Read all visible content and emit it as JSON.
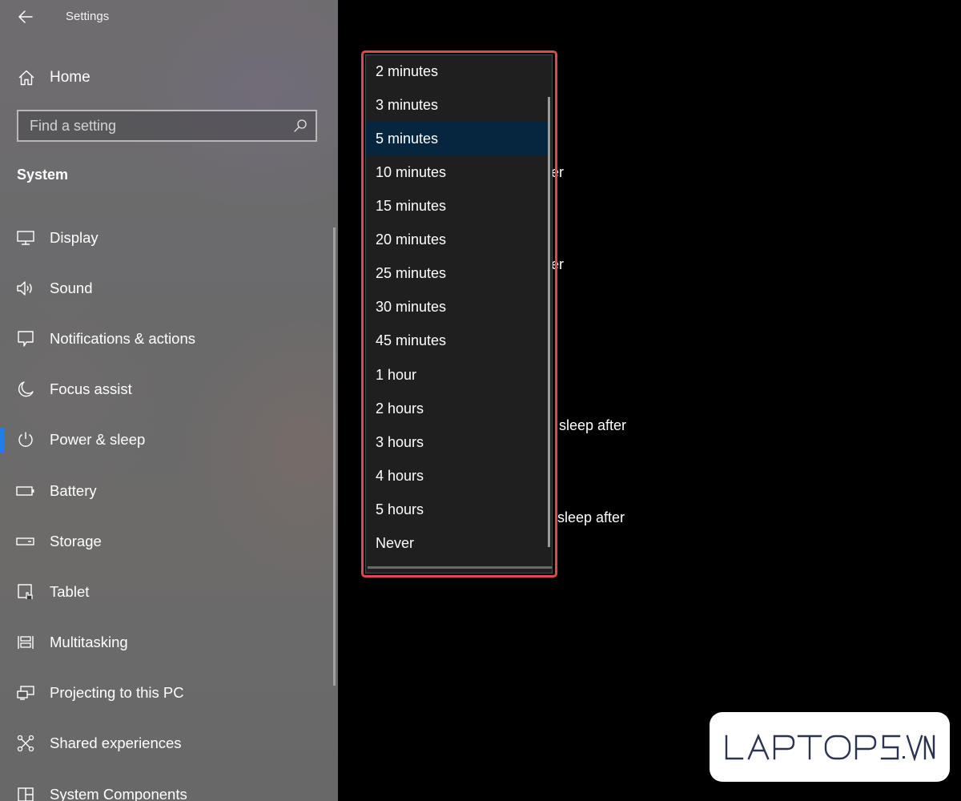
{
  "window": {
    "title": "Settings"
  },
  "sidebar": {
    "home_label": "Home",
    "search": {
      "placeholder": "Find a setting",
      "value": ""
    },
    "section_heading": "System",
    "items": [
      {
        "label": "Display",
        "icon": "monitor-icon"
      },
      {
        "label": "Sound",
        "icon": "speaker-icon"
      },
      {
        "label": "Notifications & actions",
        "icon": "notification-icon"
      },
      {
        "label": "Focus assist",
        "icon": "moon-icon"
      },
      {
        "label": "Power & sleep",
        "icon": "power-icon",
        "active": true
      },
      {
        "label": "Battery",
        "icon": "battery-icon"
      },
      {
        "label": "Storage",
        "icon": "storage-icon"
      },
      {
        "label": "Tablet",
        "icon": "tablet-icon"
      },
      {
        "label": "Multitasking",
        "icon": "multitasking-icon"
      },
      {
        "label": "Projecting to this PC",
        "icon": "projecting-icon"
      },
      {
        "label": "Shared experiences",
        "icon": "shared-experiences-icon"
      },
      {
        "label": "System Components",
        "icon": "system-components-icon"
      }
    ]
  },
  "content": {
    "partial_labels": [
      "er",
      "er",
      "sleep after",
      "sleep after"
    ]
  },
  "dropdown": {
    "selected": "5 minutes",
    "options": [
      "2 minutes",
      "3 minutes",
      "5 minutes",
      "10 minutes",
      "15 minutes",
      "20 minutes",
      "25 minutes",
      "30 minutes",
      "45 minutes",
      "1 hour",
      "2 hours",
      "3 hours",
      "4 hours",
      "5 hours",
      "Never"
    ]
  },
  "watermark": {
    "text": "LAPTOPS.VN"
  },
  "colors": {
    "accent": "#1f7ee8",
    "selected_option": "#06263f",
    "highlight_border": "#e0464a",
    "watermark_text": "#2b3350"
  }
}
